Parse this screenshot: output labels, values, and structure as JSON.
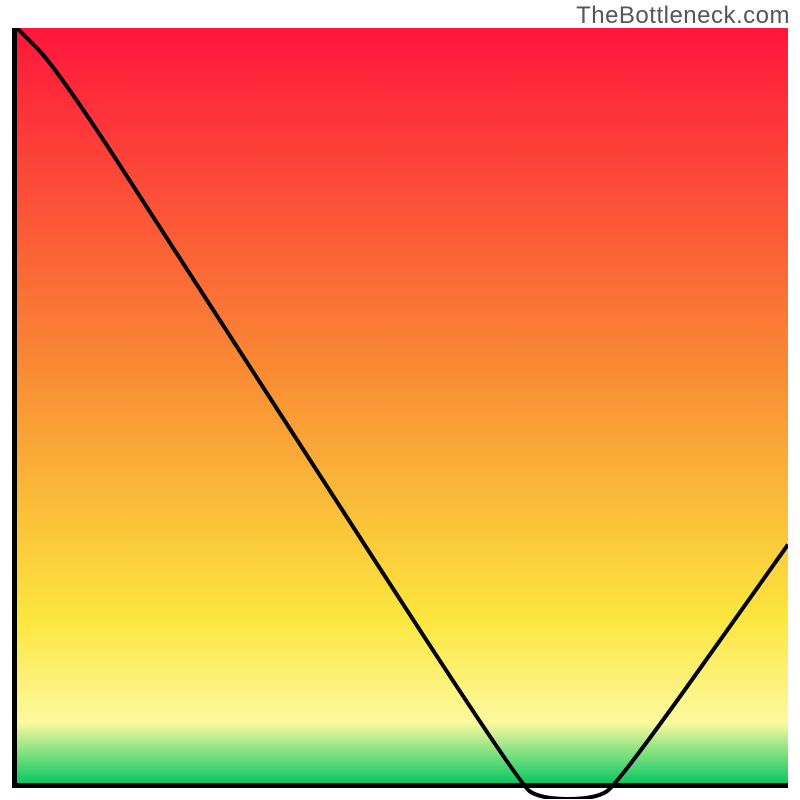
{
  "watermark": "TheBottleneck.com",
  "colors": {
    "axis": "#000000",
    "curve": "#000000",
    "marker": "#e76f6f",
    "gradient_top": "#fe163c",
    "gradient_mid1": "#f98a34",
    "gradient_mid2": "#fce63e",
    "gradient_mid3": "#fcf99e",
    "gradient_bottom": "#0ac864"
  },
  "chart_data": {
    "type": "line",
    "title": "",
    "xlabel": "",
    "ylabel": "",
    "x": [
      0,
      5,
      20,
      65,
      68,
      75,
      78,
      100
    ],
    "values": [
      100,
      95,
      72,
      2,
      0,
      0,
      2,
      33
    ],
    "xlim": [
      0,
      100
    ],
    "ylim": [
      0,
      100
    ],
    "marker": {
      "x_start": 68,
      "x_end": 76,
      "y": 0
    },
    "annotations": [],
    "legend": false,
    "grid": false
  }
}
